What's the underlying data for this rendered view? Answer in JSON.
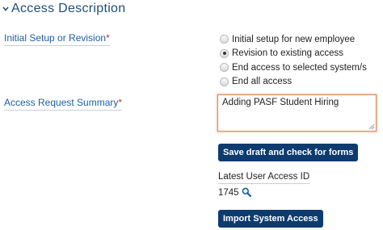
{
  "section": {
    "title": "Access Description"
  },
  "initial_setup": {
    "label": "Initial Setup or Revision",
    "required_mark": "*",
    "options": [
      {
        "label": "Initial setup for new employee",
        "checked": false
      },
      {
        "label": "Revision to existing access",
        "checked": true
      },
      {
        "label": "End access to selected system/s",
        "checked": false
      },
      {
        "label": "End all access",
        "checked": false
      }
    ]
  },
  "summary": {
    "label": "Access Request Summary",
    "required_mark": "*",
    "value": "Adding PASF Student Hiring"
  },
  "buttons": {
    "save_draft": "Save draft and check for forms",
    "import_access": "Import System Access"
  },
  "latest_access": {
    "label": "Latest User Access ID",
    "value": "1745"
  },
  "colors": {
    "heading": "#1f4e79",
    "label": "#1f5fa0",
    "required": "#c0392b",
    "button": "#0d3b6e",
    "focus_border": "#d98a5c"
  },
  "icons": {
    "collapse": "chevron-down-icon",
    "search": "magnifier-icon"
  }
}
